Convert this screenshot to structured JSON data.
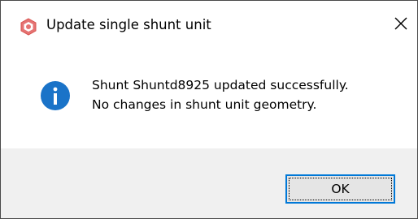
{
  "window": {
    "title": "Update single shunt unit",
    "app_icon": "app-logo-icon",
    "close_icon": "close-icon",
    "accent_color": "#0078d7",
    "footer_color": "#f0f0f0"
  },
  "message": {
    "icon": "info-icon",
    "line1": "Shunt Shuntd8925 updated successfully.",
    "line2": "No changes in shunt unit geometry."
  },
  "buttons": {
    "ok_label": "OK"
  }
}
